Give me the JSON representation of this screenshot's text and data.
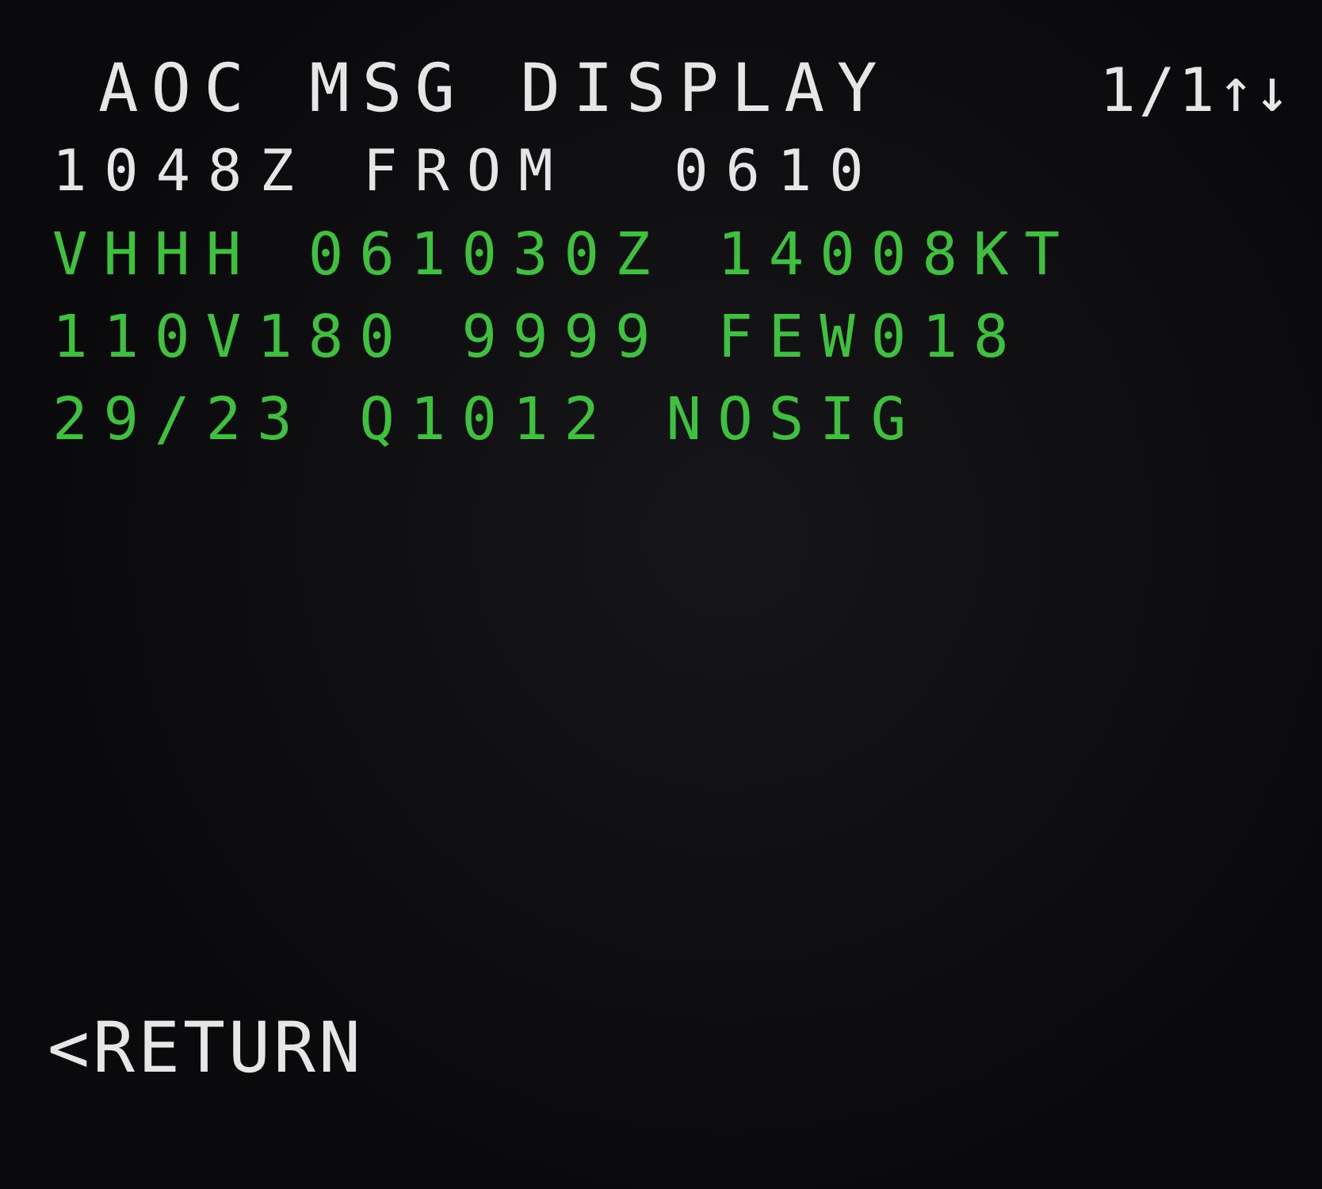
{
  "title": "AOC MSG DISPLAY",
  "page": "1/1",
  "scroll_arrows": "↑↓",
  "header_line": "1048Z FROM  0610",
  "message_lines": [
    "VHHH 061030Z 14008KT",
    "110V180 9999 FEW018",
    "29/23 Q1012 NOSIG"
  ],
  "return_prompt": "<RETURN"
}
